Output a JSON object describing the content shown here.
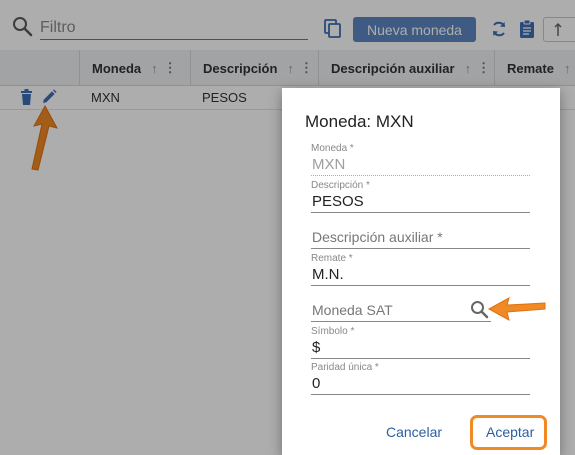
{
  "toolbar": {
    "filter_placeholder": "Filtro",
    "new_button_label": "Nueva moneda",
    "search_icon": "search-icon",
    "copy_icon": "copy-icon",
    "refresh_icon": "refresh-icon",
    "clipboard_icon": "clipboard-icon"
  },
  "table": {
    "columns": [
      {
        "label": "Moneda"
      },
      {
        "label": "Descripción"
      },
      {
        "label": "Descripción auxiliar"
      },
      {
        "label": "Remate"
      }
    ],
    "rows": [
      {
        "moneda": "MXN",
        "descripcion": "PESOS"
      }
    ],
    "sort_glyph": "↑",
    "menu_glyph": "⋮"
  },
  "dialog": {
    "title": "Moneda: MXN",
    "fields": {
      "moneda": {
        "label": "Moneda *",
        "value": "MXN"
      },
      "descripcion": {
        "label": "Descripción *",
        "value": "PESOS"
      },
      "descripcion_aux": {
        "placeholder": "Descripción auxiliar *"
      },
      "remate": {
        "label": "Remate *",
        "value": "M.N."
      },
      "moneda_sat": {
        "placeholder": "Moneda SAT"
      },
      "simbolo": {
        "label": "Símbolo *",
        "value": "$"
      },
      "paridad": {
        "label": "Paridad única *",
        "value": "0"
      }
    },
    "cancel_label": "Cancelar",
    "accept_label": "Aceptar"
  },
  "colors": {
    "primary": "#5d86c3",
    "link": "#2a5fa0",
    "annotation": "#f08a24"
  }
}
